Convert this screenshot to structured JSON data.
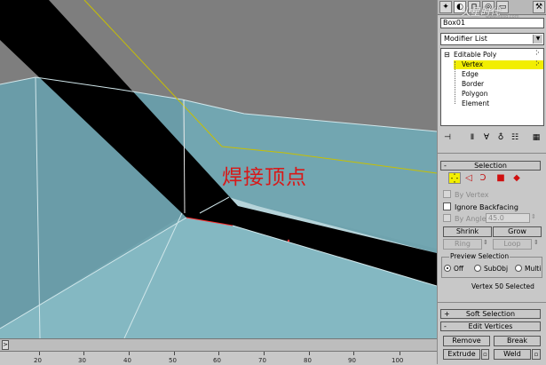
{
  "viewport": {
    "overlay_label": "焊接顶点"
  },
  "command_panel": {
    "watermark_text": "火星时代",
    "watermark_url": "www.hxsd.com",
    "object_name": "Box01",
    "modifier_list": {
      "value": "Modifier List"
    },
    "stack": {
      "root": "Editable Poly",
      "sub_objects": [
        {
          "label": "Vertex",
          "selected": true
        },
        {
          "label": "Edge",
          "selected": false
        },
        {
          "label": "Border",
          "selected": false
        },
        {
          "label": "Polygon",
          "selected": false
        },
        {
          "label": "Element",
          "selected": false
        }
      ]
    },
    "selection_rollout": {
      "title": "Selection",
      "collapse_sign": "-",
      "options": {
        "by_vertex": "By Vertex",
        "ignore_backfacing": "Ignore Backfacing",
        "by_angle": "By Angle:",
        "angle_value": "45.0"
      },
      "buttons": {
        "shrink": "Shrink",
        "grow": "Grow",
        "ring": "Ring",
        "loop": "Loop"
      },
      "preview_selection": {
        "label": "Preview Selection",
        "options": [
          "Off",
          "SubObj",
          "Multi"
        ],
        "selected": "Off"
      },
      "status": "Vertex 50 Selected"
    },
    "soft_selection_rollout": {
      "title": "Soft Selection",
      "sign": "+"
    },
    "edit_vertices_rollout": {
      "title": "Edit Vertices",
      "sign": "-",
      "buttons": {
        "remove": "Remove",
        "break": "Break",
        "extrude": "Extrude",
        "weld": "Weld"
      }
    }
  },
  "timeline": {
    "arrow": ">",
    "ruler_labels": [
      "20",
      "30",
      "40",
      "50",
      "60",
      "70",
      "80",
      "90",
      "100"
    ]
  }
}
